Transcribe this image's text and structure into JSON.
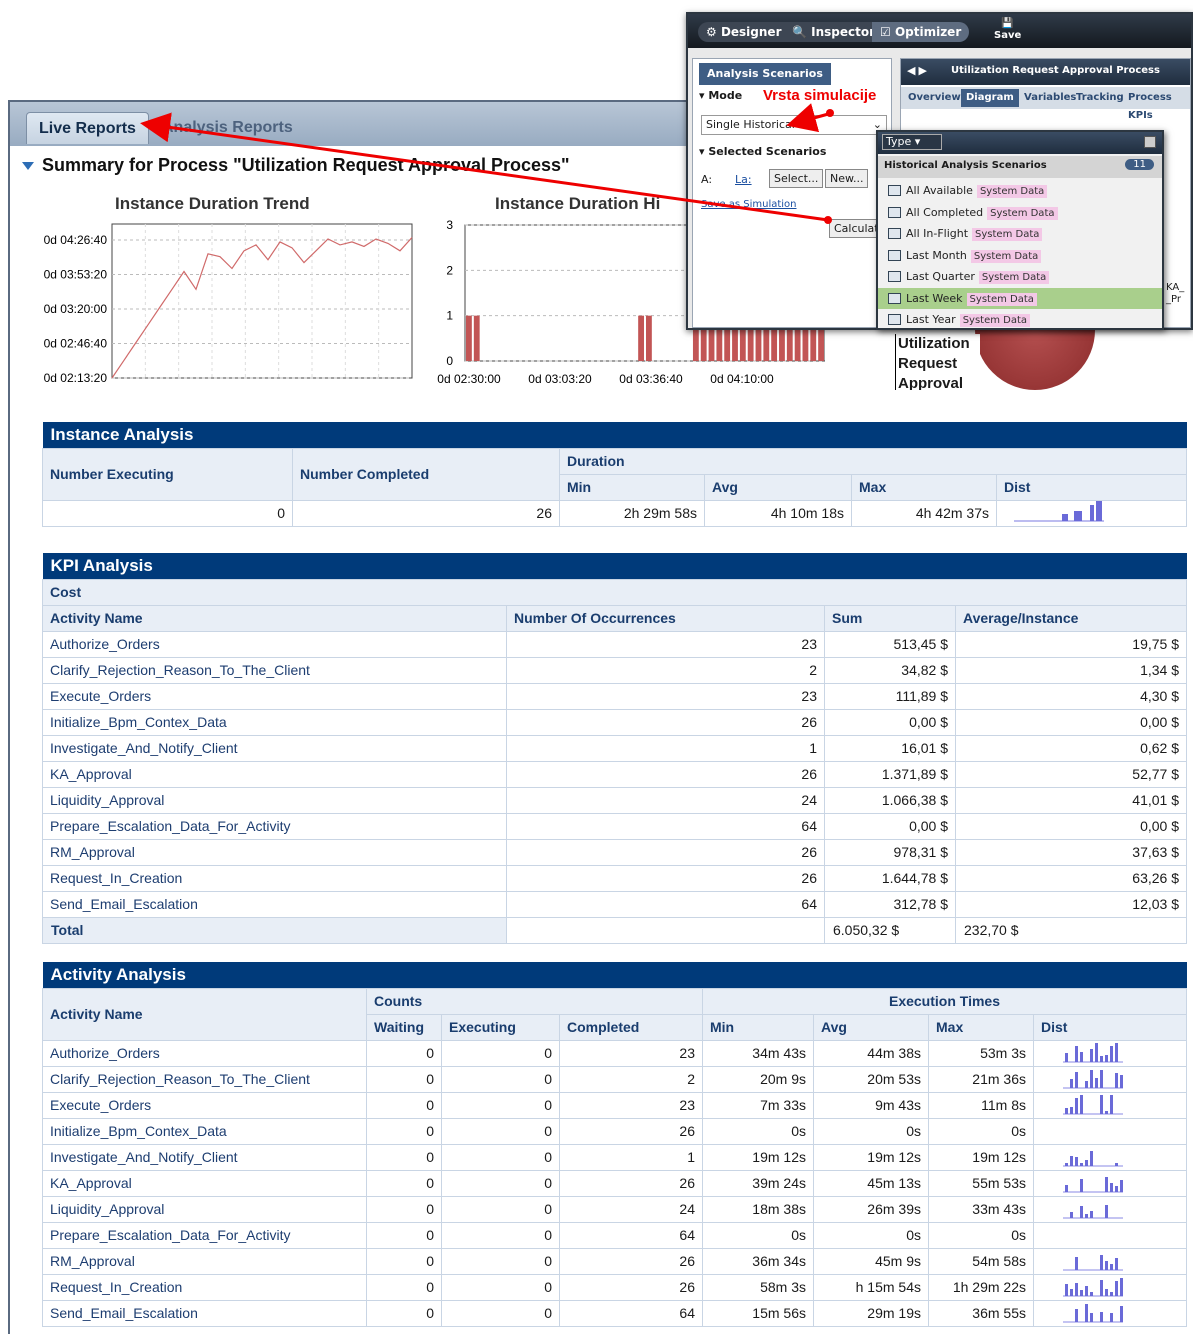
{
  "tabs": {
    "live": "Live Reports",
    "analysis": "Analysis Reports"
  },
  "summary_title": "Summary for Process \"Utilization Request Approval Process\"",
  "charts": {
    "trend": {
      "title": "Instance Duration Trend",
      "yticks": [
        "0d 04:26:40",
        "0d 03:53:20",
        "0d 03:20:00",
        "0d 02:46:40",
        "0d 02:13:20"
      ]
    },
    "hist": {
      "title": "Instance Duration Hi",
      "yticks": [
        "3",
        "2",
        "1",
        "0"
      ],
      "xticks": [
        "0d 02:30:00",
        "0d 03:03:20",
        "0d 03:36:40",
        "0d 04:10:00"
      ]
    },
    "pie_label": [
      "Utilization",
      "Request",
      "Approval"
    ]
  },
  "chart_data": [
    {
      "type": "line",
      "title": "Instance Duration Trend",
      "ylabel": "",
      "ylim": [
        "0d 02:13:20",
        "0d 04:53:20"
      ],
      "y_seconds": [
        8000,
        9200,
        10400,
        11600,
        12800,
        14000,
        15200,
        14000,
        16400,
        16200,
        15400,
        16600,
        17000,
        16000,
        17200,
        16800,
        15800,
        16600,
        17400,
        17000,
        17200,
        16900,
        17400,
        17100,
        16600,
        17500
      ]
    },
    {
      "type": "bar",
      "title": "Instance Duration Hi",
      "xticks": [
        "0d 02:30:00",
        "0d 03:03:20",
        "0d 03:36:40",
        "0d 04:10:00"
      ],
      "ylim": [
        0,
        3
      ],
      "values": [
        1,
        1,
        0,
        0,
        0,
        0,
        0,
        0,
        0,
        0,
        0,
        0,
        0,
        0,
        0,
        0,
        0,
        0,
        0,
        0,
        0,
        0,
        1,
        1,
        0,
        0,
        0,
        0,
        0,
        1,
        1,
        1,
        1,
        1,
        1,
        1,
        1,
        1,
        1,
        1,
        1,
        1,
        1,
        1,
        1,
        1
      ]
    }
  ],
  "instance": {
    "title": "Instance Analysis",
    "h_exec": "Number Executing",
    "h_comp": "Number Completed",
    "h_duration": "Duration",
    "h_min": "Min",
    "h_avg": "Avg",
    "h_max": "Max",
    "h_dist": "Dist",
    "exec": "0",
    "comp": "26",
    "min": "2h 29m 58s",
    "avg": "4h 10m 18s",
    "max": "4h 42m 37s"
  },
  "kpi": {
    "title": "KPI Analysis",
    "group": "Cost",
    "h_name": "Activity Name",
    "h_occ": "Number Of Occurrences",
    "h_sum": "Sum",
    "h_avg": "Average/Instance",
    "rows": [
      [
        "Authorize_Orders",
        "23",
        "513,45 $",
        "19,75 $"
      ],
      [
        "Clarify_Rejection_Reason_To_The_Client",
        "2",
        "34,82 $",
        "1,34 $"
      ],
      [
        "Execute_Orders",
        "23",
        "111,89 $",
        "4,30 $"
      ],
      [
        "Initialize_Bpm_Contex_Data",
        "26",
        "0,00 $",
        "0,00 $"
      ],
      [
        "Investigate_And_Notify_Client",
        "1",
        "16,01 $",
        "0,62 $"
      ],
      [
        "KA_Approval",
        "26",
        "1.371,89 $",
        "52,77 $"
      ],
      [
        "Liquidity_Approval",
        "24",
        "1.066,38 $",
        "41,01 $"
      ],
      [
        "Prepare_Escalation_Data_For_Activity",
        "64",
        "0,00 $",
        "0,00 $"
      ],
      [
        "RM_Approval",
        "26",
        "978,31 $",
        "37,63 $"
      ],
      [
        "Request_In_Creation",
        "26",
        "1.644,78 $",
        "63,26 $"
      ],
      [
        "Send_Email_Escalation",
        "64",
        "312,78 $",
        "12,03 $"
      ]
    ],
    "total": [
      "Total",
      "",
      "6.050,32 $",
      "232,70 $"
    ]
  },
  "activity": {
    "title": "Activity Analysis",
    "h_name": "Activity Name",
    "h_counts": "Counts",
    "h_exec_times": "Execution Times",
    "h_waiting": "Waiting",
    "h_executing": "Executing",
    "h_completed": "Completed",
    "h_min": "Min",
    "h_avg": "Avg",
    "h_max": "Max",
    "h_dist": "Dist",
    "rows": [
      [
        "Authorize_Orders",
        "0",
        "0",
        "23",
        "34m 43s",
        "44m 38s",
        "53m 3s"
      ],
      [
        "Clarify_Rejection_Reason_To_The_Client",
        "0",
        "0",
        "2",
        "20m 9s",
        "20m 53s",
        "21m 36s"
      ],
      [
        "Execute_Orders",
        "0",
        "0",
        "23",
        "7m 33s",
        "9m 43s",
        "11m 8s"
      ],
      [
        "Initialize_Bpm_Contex_Data",
        "0",
        "0",
        "26",
        "0s",
        "0s",
        "0s"
      ],
      [
        "Investigate_And_Notify_Client",
        "0",
        "0",
        "1",
        "19m 12s",
        "19m 12s",
        "19m 12s"
      ],
      [
        "KA_Approval",
        "0",
        "0",
        "26",
        "39m 24s",
        "45m 13s",
        "55m 53s"
      ],
      [
        "Liquidity_Approval",
        "0",
        "0",
        "24",
        "18m 38s",
        "26m 39s",
        "33m 43s"
      ],
      [
        "Prepare_Escalation_Data_For_Activity",
        "0",
        "0",
        "64",
        "0s",
        "0s",
        "0s"
      ],
      [
        "RM_Approval",
        "0",
        "0",
        "26",
        "36m 34s",
        "45m 9s",
        "54m 58s"
      ],
      [
        "Request_In_Creation",
        "0",
        "0",
        "26",
        "58m 3s",
        "h 15m 54s",
        "1h 29m 22s"
      ],
      [
        "Send_Email_Escalation",
        "0",
        "0",
        "64",
        "15m 56s",
        "29m 19s",
        "36m 55s"
      ]
    ]
  },
  "designer": {
    "designer": "Designer",
    "inspector": "Inspector",
    "optimizer": "Optimizer",
    "save": "Save",
    "analysis_scenarios": "Analysis Scenarios",
    "mode": "Mode",
    "mode_value": "Single Historical",
    "vrsta": "Vrsta simulacije",
    "selected": "Selected Scenarios",
    "a_label": "A:",
    "la": "La:",
    "select_btn": "Select...",
    "new_btn": "New...",
    "save_as": "Save as Simulation",
    "calculate": "Calculate",
    "process_tab": "Utilization Request Approval Process",
    "ptabs": [
      "Overview",
      "Diagram",
      "Variables",
      "Tracking",
      "Process KPIs"
    ],
    "type_label": "Type",
    "hist_header": "Historical Analysis Scenarios",
    "hist_count": "11",
    "scenarios": [
      "All Available",
      "All Completed",
      "All In-Flight",
      "Last Month",
      "Last Quarter",
      "Last Week",
      "Last Year"
    ],
    "system_data": "System Data",
    "ka_label": "KA_",
    "pr_label": "_Pr"
  }
}
